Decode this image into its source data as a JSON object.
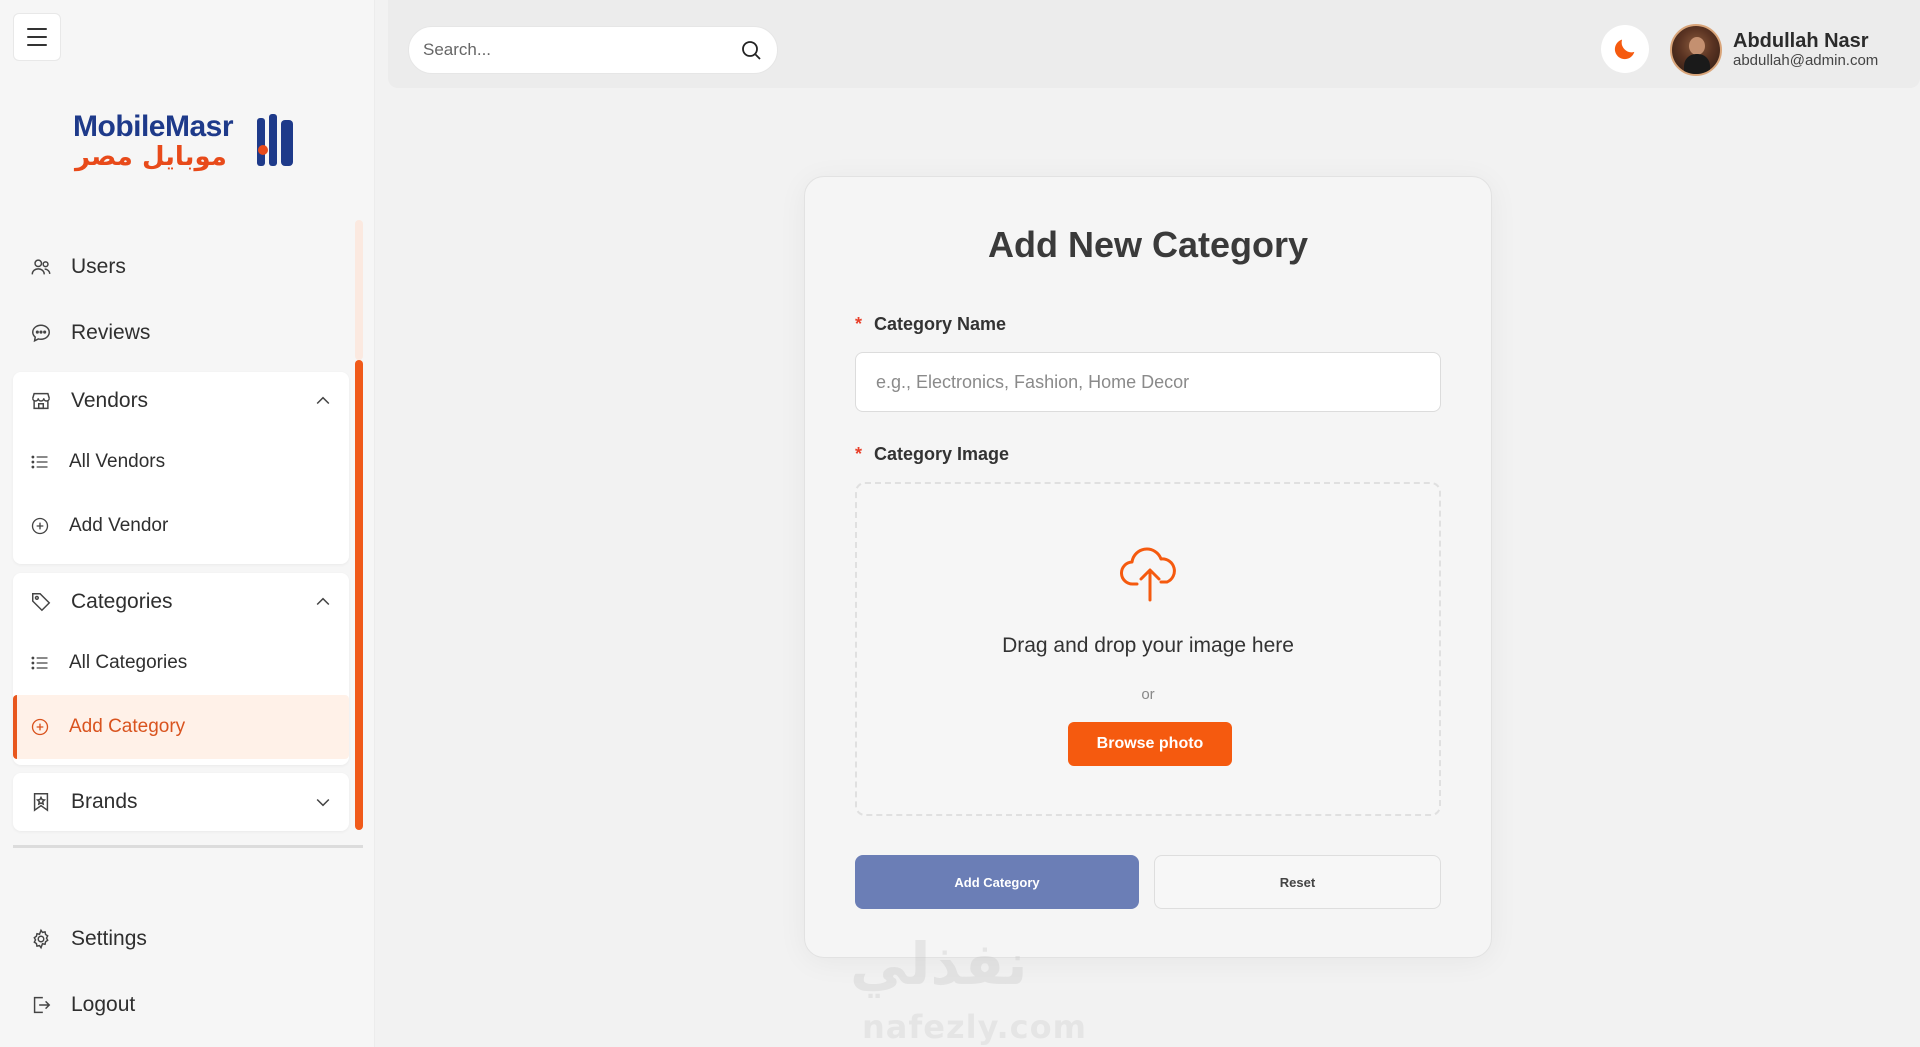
{
  "brand": {
    "name_en": "MobileMasr",
    "name_ar": "موبايل مصر",
    "colors": {
      "primary": "#1e3a8a",
      "accent": "#f55a0f",
      "active_bg": "#fff1e8"
    }
  },
  "sidebar": {
    "menu_icon": "hamburger-icon",
    "items": [
      {
        "label": "Users",
        "icon": "users-icon"
      },
      {
        "label": "Reviews",
        "icon": "chat-bubble-icon"
      }
    ],
    "groups": [
      {
        "label": "Vendors",
        "icon": "store-icon",
        "expanded": true,
        "children": [
          {
            "label": "All Vendors",
            "icon": "list-icon"
          },
          {
            "label": "Add Vendor",
            "icon": "plus-circle-icon"
          }
        ]
      },
      {
        "label": "Categories",
        "icon": "tag-icon",
        "expanded": true,
        "children": [
          {
            "label": "All Categories",
            "icon": "list-icon"
          },
          {
            "label": "Add Category",
            "icon": "plus-circle-icon",
            "active": true
          }
        ]
      },
      {
        "label": "Brands",
        "icon": "bookmark-icon",
        "expanded": false
      }
    ],
    "footer": [
      {
        "label": "Settings",
        "icon": "gear-icon"
      },
      {
        "label": "Logout",
        "icon": "logout-icon"
      }
    ]
  },
  "header": {
    "search_placeholder": "Search...",
    "theme_icon": "moon-icon",
    "user": {
      "name": "Abdullah Nasr",
      "email": "abdullah@admin.com"
    }
  },
  "form": {
    "title": "Add New Category",
    "name_label": "Category Name",
    "name_placeholder": "e.g., Electronics, Fashion, Home Decor",
    "name_value": "",
    "required_marker": "*",
    "image_label": "Category Image",
    "dropzone_text": "Drag and drop your image here",
    "dropzone_or": "or",
    "browse_label": "Browse photo",
    "submit_label": "Add Category",
    "reset_label": "Reset"
  },
  "watermark": {
    "ar": "نفذلي",
    "en": "nafezly.com"
  }
}
